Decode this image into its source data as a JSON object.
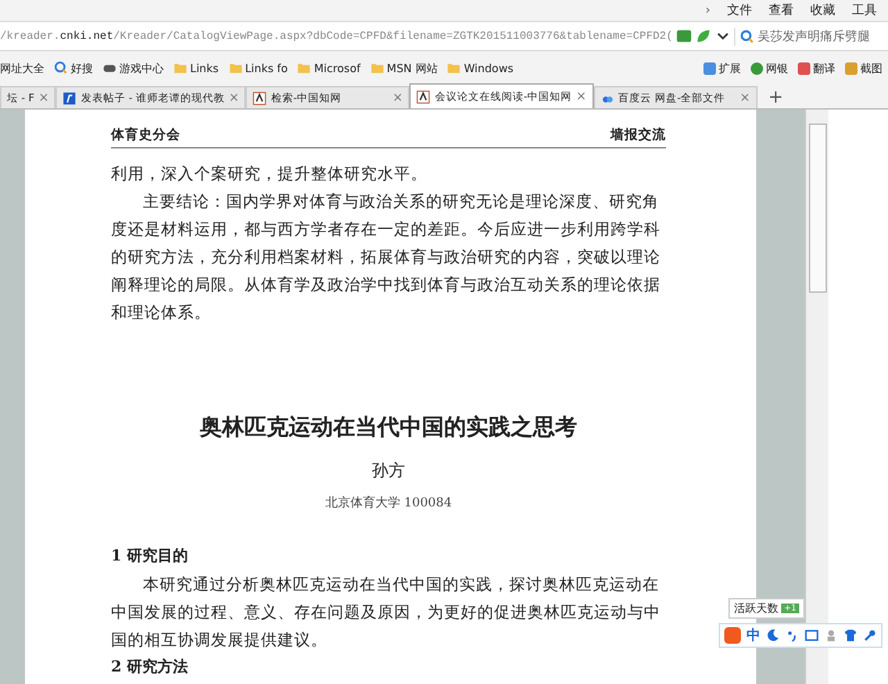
{
  "menu_chevron": "›",
  "menu": [
    "文件",
    "查看",
    "收藏",
    "工具"
  ],
  "address": {
    "prefix": "/kreader.",
    "domain": "cnki.net",
    "path": "/Kreader/CatalogViewPage.aspx?dbCode=CPFD&filename=ZGTK201511003776&tablename=CPFD2("
  },
  "search": {
    "value": "吴莎发声明痛斥劈腿"
  },
  "bookmarks": [
    {
      "label": "网址大全",
      "kind": "globe"
    },
    {
      "label": "好搜",
      "kind": "search"
    },
    {
      "label": "游戏中心",
      "kind": "game"
    },
    {
      "label": "Links",
      "kind": "folder"
    },
    {
      "label": "Links fo",
      "kind": "folder"
    },
    {
      "label": "Microsof",
      "kind": "folder"
    },
    {
      "label": "MSN 网站",
      "kind": "folder"
    },
    {
      "label": "Windows",
      "kind": "folder"
    }
  ],
  "tools": [
    "扩展",
    "网银",
    "翻译",
    "截图"
  ],
  "tabs": [
    {
      "label": "坛 - F",
      "kind": "none",
      "selected": false,
      "close": "×"
    },
    {
      "label": "发表帖子 - 谁师老谭的现代教",
      "kind": "forum",
      "selected": false,
      "close": "×"
    },
    {
      "label": "检索-中国知网",
      "kind": "cnki",
      "selected": false,
      "close": "×"
    },
    {
      "label": "会议论文在线阅读-中国知网",
      "kind": "cnki",
      "selected": true,
      "close": "×"
    },
    {
      "label": "百度云 网盘-全部文件",
      "kind": "cloud",
      "selected": false,
      "close": "×"
    }
  ],
  "new_tab": "+",
  "document": {
    "header_left": "体育史分会",
    "header_right": "墙报交流",
    "paragraphs": [
      {
        "text": "利用，深入个案研究，提升整体研究水平。",
        "indent": false
      },
      {
        "text": "主要结论：国内学界对体育与政治关系的研究无论是理论深度、研究角度还是材料运用，都与西方学者存在一定的差距。今后应进一步利用跨学科的研究方法，充分利用档案材料，拓展体育与政治研究的内容，突破以理论阐释理论的局限。从体育学及政治学中找到体育与政治互动关系的理论依据和理论体系。",
        "indent": true
      }
    ],
    "title": "奥林匹克运动在当代中国的实践之思考",
    "author": "孙方",
    "affiliation": "北京体育大学  100084",
    "sections": [
      {
        "heading": "1  研究目的",
        "paragraphs": [
          "本研究通过分析奥林匹克运动在当代中国的实践，探讨奥林匹克运动在中国发展的过程、意义、存在问题及原因，为更好的促进奥林匹克运动与中国的相互协调发展提供建议。"
        ]
      },
      {
        "heading": "2  研究方法"
      }
    ]
  },
  "ime": {
    "tooltip": "活跃天数",
    "badge": "+1",
    "mode": "中"
  }
}
